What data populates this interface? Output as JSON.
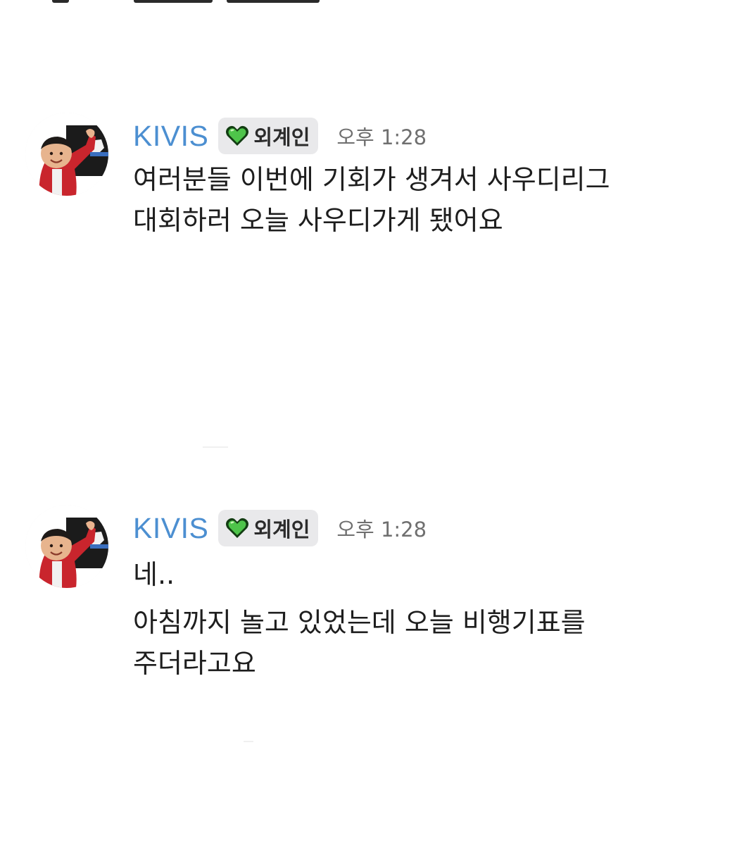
{
  "messages": [
    {
      "username": "KIVIS",
      "role_badge": {
        "icon": "green-heart-icon",
        "label": "외계인",
        "color": "#4ec44a"
      },
      "timestamp": "오후 1:28",
      "lines": [
        "여러분들 이번에 기회가 생겨서 사우디리그",
        "대회하러 오늘 사우디가게 됐어요"
      ]
    },
    {
      "username": "KIVIS",
      "role_badge": {
        "icon": "green-heart-icon",
        "label": "외계인",
        "color": "#4ec44a"
      },
      "timestamp": "오후 1:28",
      "lines": [
        "네..",
        "아침까지 놀고 있었는데 오늘 비행기표를",
        "주더라고요"
      ]
    }
  ],
  "colors": {
    "username": "#4c8fd1",
    "badge_background": "#e9e9eb",
    "timestamp": "#6f6f6f",
    "message_text": "#1e1e1e"
  }
}
